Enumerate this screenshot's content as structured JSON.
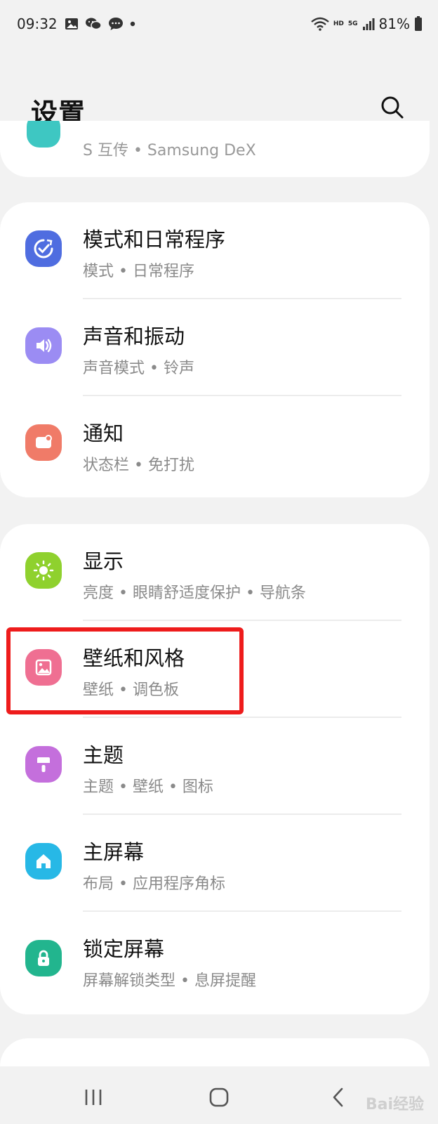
{
  "status_bar": {
    "time": "09:32",
    "network": "HD",
    "network2": "5G",
    "battery": "81%"
  },
  "header": {
    "title": "设置"
  },
  "partial_item": {
    "subtitle": "S 互传 • Samsung DeX"
  },
  "groups": [
    {
      "items": [
        {
          "title": "模式和日常程序",
          "subtitle": "模式 • 日常程序",
          "icon": "modes-routines-icon",
          "color": "#4f6de0"
        },
        {
          "title": "声音和振动",
          "subtitle": "声音模式 • 铃声",
          "icon": "sound-icon",
          "color": "#9b8cf3"
        },
        {
          "title": "通知",
          "subtitle": "状态栏 • 免打扰",
          "icon": "notification-icon",
          "color": "#f07b68"
        }
      ]
    },
    {
      "items": [
        {
          "title": "显示",
          "subtitle": "亮度 • 眼睛舒适度保护 • 导航条",
          "icon": "display-sun-icon",
          "color": "#8fd12e"
        },
        {
          "title": "壁纸和风格",
          "subtitle": "壁纸 • 调色板",
          "icon": "wallpaper-icon",
          "color": "#ef6f92"
        },
        {
          "title": "主题",
          "subtitle": "主题 • 壁纸 • 图标",
          "icon": "theme-brush-icon",
          "color": "#c46fdc"
        },
        {
          "title": "主屏幕",
          "subtitle": "布局 • 应用程序角标",
          "icon": "home-icon",
          "color": "#27b8e6"
        },
        {
          "title": "锁定屏幕",
          "subtitle": "屏幕解锁类型 • 息屏提醒",
          "icon": "lock-icon",
          "color": "#22b58e"
        }
      ]
    }
  ],
  "watermark": "Bai经验"
}
